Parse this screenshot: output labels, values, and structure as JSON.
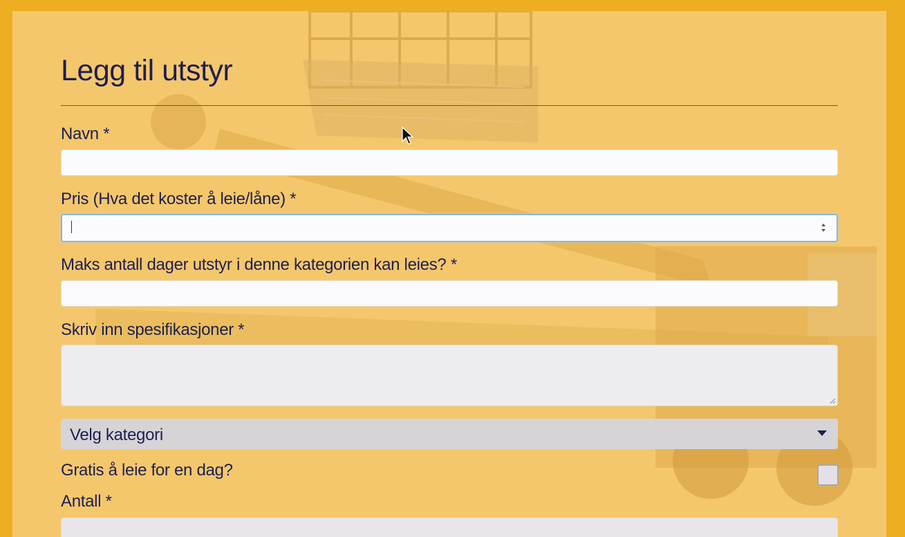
{
  "form": {
    "title": "Legg til utstyr",
    "fields": {
      "name_label": "Navn *",
      "price_label": "Pris (Hva det koster å leie/låne) *",
      "maxdays_label": "Maks antall dager utstyr i denne kategorien kan leies? *",
      "specs_label": "Skriv inn spesifikasjoner *",
      "category_selected": "Velg kategori",
      "free_label": "Gratis å leie for en dag?",
      "quantity_label": "Antall *"
    }
  },
  "colors": {
    "page_border": "#eeae22",
    "panel": "#f5c76c",
    "text": "#1d1f52",
    "input_bg": "#fbfbfd",
    "focus_ring": "#8cb6d7"
  },
  "icons": [
    "spinner-icon",
    "dropdown-arrow-icon",
    "resize-handle-icon",
    "mouse-cursor-icon"
  ]
}
